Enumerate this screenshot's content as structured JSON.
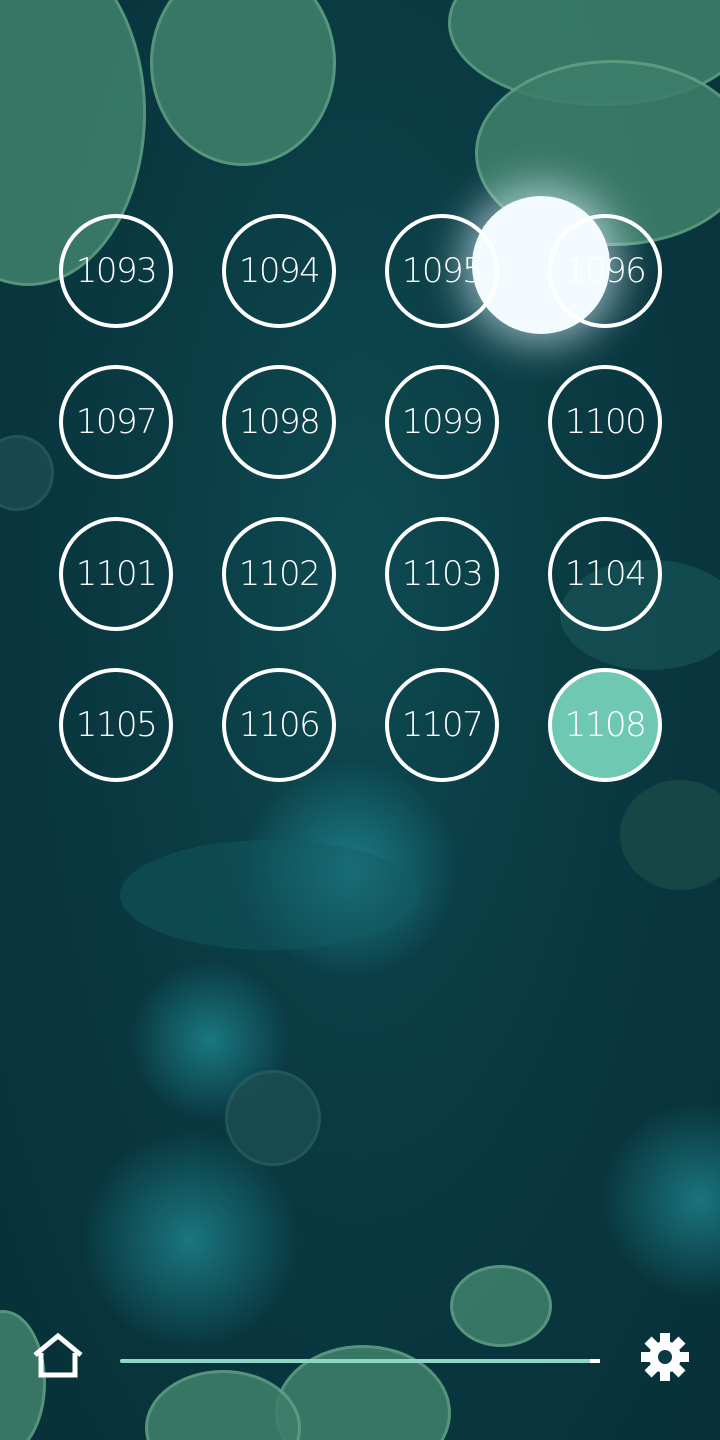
{
  "levels": [
    {
      "number": "1093",
      "completed": false
    },
    {
      "number": "1094",
      "completed": false
    },
    {
      "number": "1095",
      "completed": false
    },
    {
      "number": "1096",
      "completed": false
    },
    {
      "number": "1097",
      "completed": false
    },
    {
      "number": "1098",
      "completed": false
    },
    {
      "number": "1099",
      "completed": false
    },
    {
      "number": "1100",
      "completed": false
    },
    {
      "number": "1101",
      "completed": false
    },
    {
      "number": "1102",
      "completed": false
    },
    {
      "number": "1103",
      "completed": false
    },
    {
      "number": "1104",
      "completed": false
    },
    {
      "number": "1105",
      "completed": false
    },
    {
      "number": "1106",
      "completed": false
    },
    {
      "number": "1107",
      "completed": false
    },
    {
      "number": "1108",
      "completed": true
    }
  ],
  "progress": {
    "fraction": 0.99
  },
  "icons": {
    "home": "home-icon",
    "settings": "gear-icon"
  },
  "colors": {
    "completed_fill": "#6fc8b2",
    "ring": "#ffffff",
    "water": "#0a3a42"
  }
}
